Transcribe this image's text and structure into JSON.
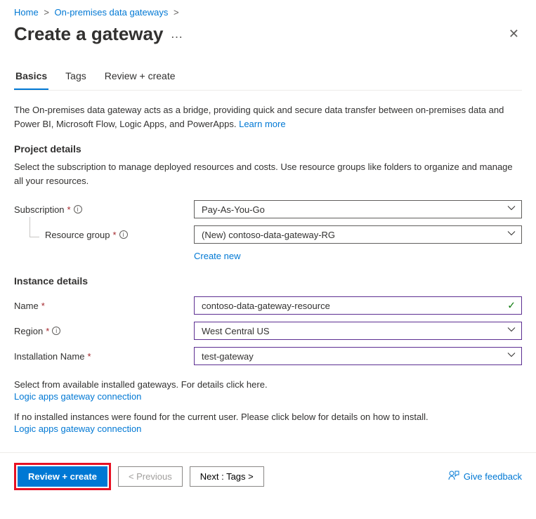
{
  "breadcrumb": {
    "home": "Home",
    "gateways": "On-premises data gateways"
  },
  "page": {
    "title": "Create a gateway"
  },
  "tabs": {
    "basics": "Basics",
    "tags": "Tags",
    "review": "Review + create"
  },
  "intro": {
    "text": "The On-premises data gateway acts as a bridge, providing quick and secure data transfer between on-premises data and Power BI, Microsoft Flow, Logic Apps, and PowerApps. ",
    "learn_more": "Learn more"
  },
  "project": {
    "heading": "Project details",
    "desc": "Select the subscription to manage deployed resources and costs. Use resource groups like folders to organize and manage all your resources.",
    "subscription_label": "Subscription",
    "subscription_value": "Pay-As-You-Go",
    "rg_label": "Resource group",
    "rg_value": "(New) contoso-data-gateway-RG",
    "create_new": "Create new"
  },
  "instance": {
    "heading": "Instance details",
    "name_label": "Name",
    "name_value": "contoso-data-gateway-resource",
    "region_label": "Region",
    "region_value": "West Central US",
    "install_label": "Installation Name",
    "install_value": "test-gateway",
    "help1": "Select from available installed gateways. For details click here.",
    "link1": "Logic apps gateway connection",
    "help2": "If no installed instances were found for the current user. Please click below for details on how to install.",
    "link2": "Logic apps gateway connection"
  },
  "footer": {
    "review": "Review + create",
    "prev": "< Previous",
    "next": "Next : Tags >",
    "feedback": "Give feedback"
  }
}
